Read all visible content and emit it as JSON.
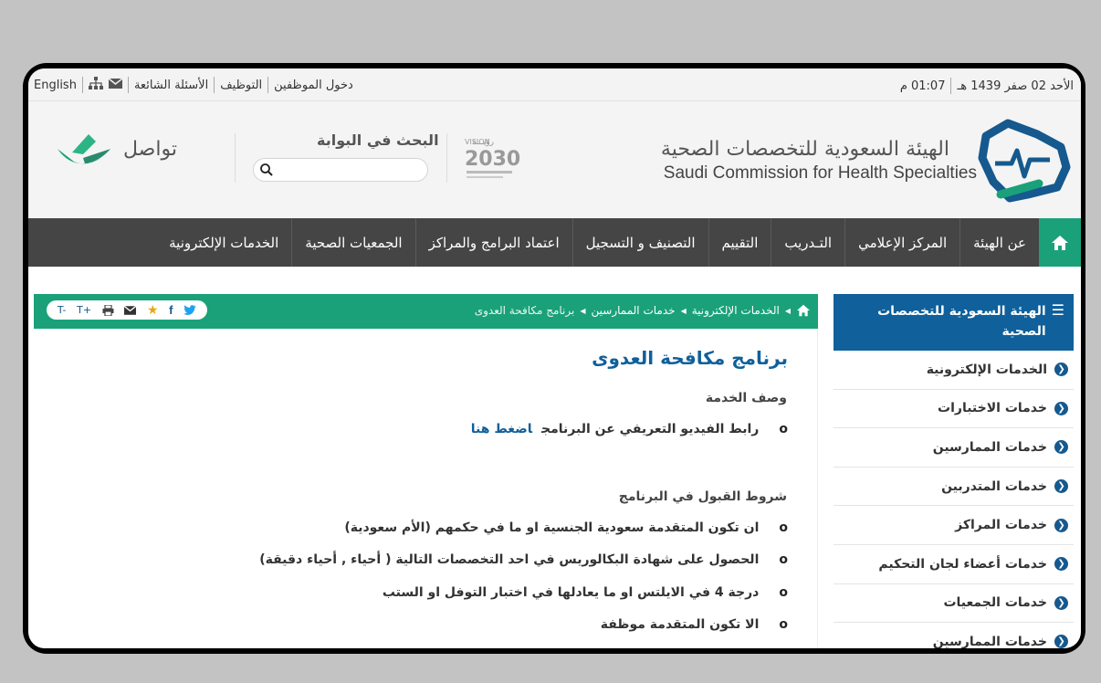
{
  "topbar": {
    "date_hijri": "الأحد 02 صفر 1439 هـ",
    "time": "01:07 م",
    "links": [
      "دخول الموظفين",
      "التوظيف",
      "الأسئلة الشائعة"
    ],
    "language": "English"
  },
  "header": {
    "org_name_ar": "الهيئة السعودية للتخصصات الصحية",
    "org_name_en": "Saudi Commission for Health Specialties",
    "vision_logo": {
      "top": "رؤيـــة",
      "vision": "VISION",
      "year": "2030"
    },
    "search_title": "البحث في البوابة",
    "search_placeholder": "",
    "tawasul": "تواصل"
  },
  "nav": {
    "items": [
      "عن الهيئة",
      "المركز الإعلامي",
      "التـدريب",
      "التقييم",
      "التصنيف و التسجيل",
      "اعتماد البرامج والمراكز",
      "الجمعيات الصحية",
      "الخدمات الإلكترونية"
    ]
  },
  "sidebar": {
    "title": "الهيئة السعودية للتخصصات الصحية",
    "items": [
      "الخدمات الإلكترونية",
      "خدمات الاختبارات",
      "خدمات الممارسين",
      "خدمات المتدربين",
      "خدمات المراكز",
      "خدمات أعضاء لجان التحكيم",
      "خدمات الجمعيات",
      "خدمات الممارسين"
    ]
  },
  "breadcrumb": {
    "items": [
      "الخدمات الإلكترونية",
      "خدمات الممارسين",
      "برنامج مكافحة العدوى"
    ]
  },
  "share": {
    "font_up": "T+",
    "font_down": "T-"
  },
  "content": {
    "title": "برنامج مكافحة العدوى",
    "service_desc_heading": "وصف الخدمة",
    "video_bullet": "رابط الفيديو التعريفي عن البرنامج",
    "video_link": "اضغط هنا",
    "conditions_heading": "شروط القبول في البرنامج",
    "conditions": [
      "ان تكون المتقدمة سعودية الجنسية  او ما في حكمهم (الأم سعودية)",
      "الحصول على شهادة البكالوريس في احد التخصصات التالية ( أحياء , أحياء دقيقة)",
      "درجة 4 في الايلتس او ما يعادلها في اختبار التوفل او الستب",
      "الا تكون المتقدمة موظفة"
    ],
    "bullet_marker": "o"
  },
  "colors": {
    "green": "#1aa179",
    "blue": "#0f609b",
    "nav_bg": "#454545"
  }
}
